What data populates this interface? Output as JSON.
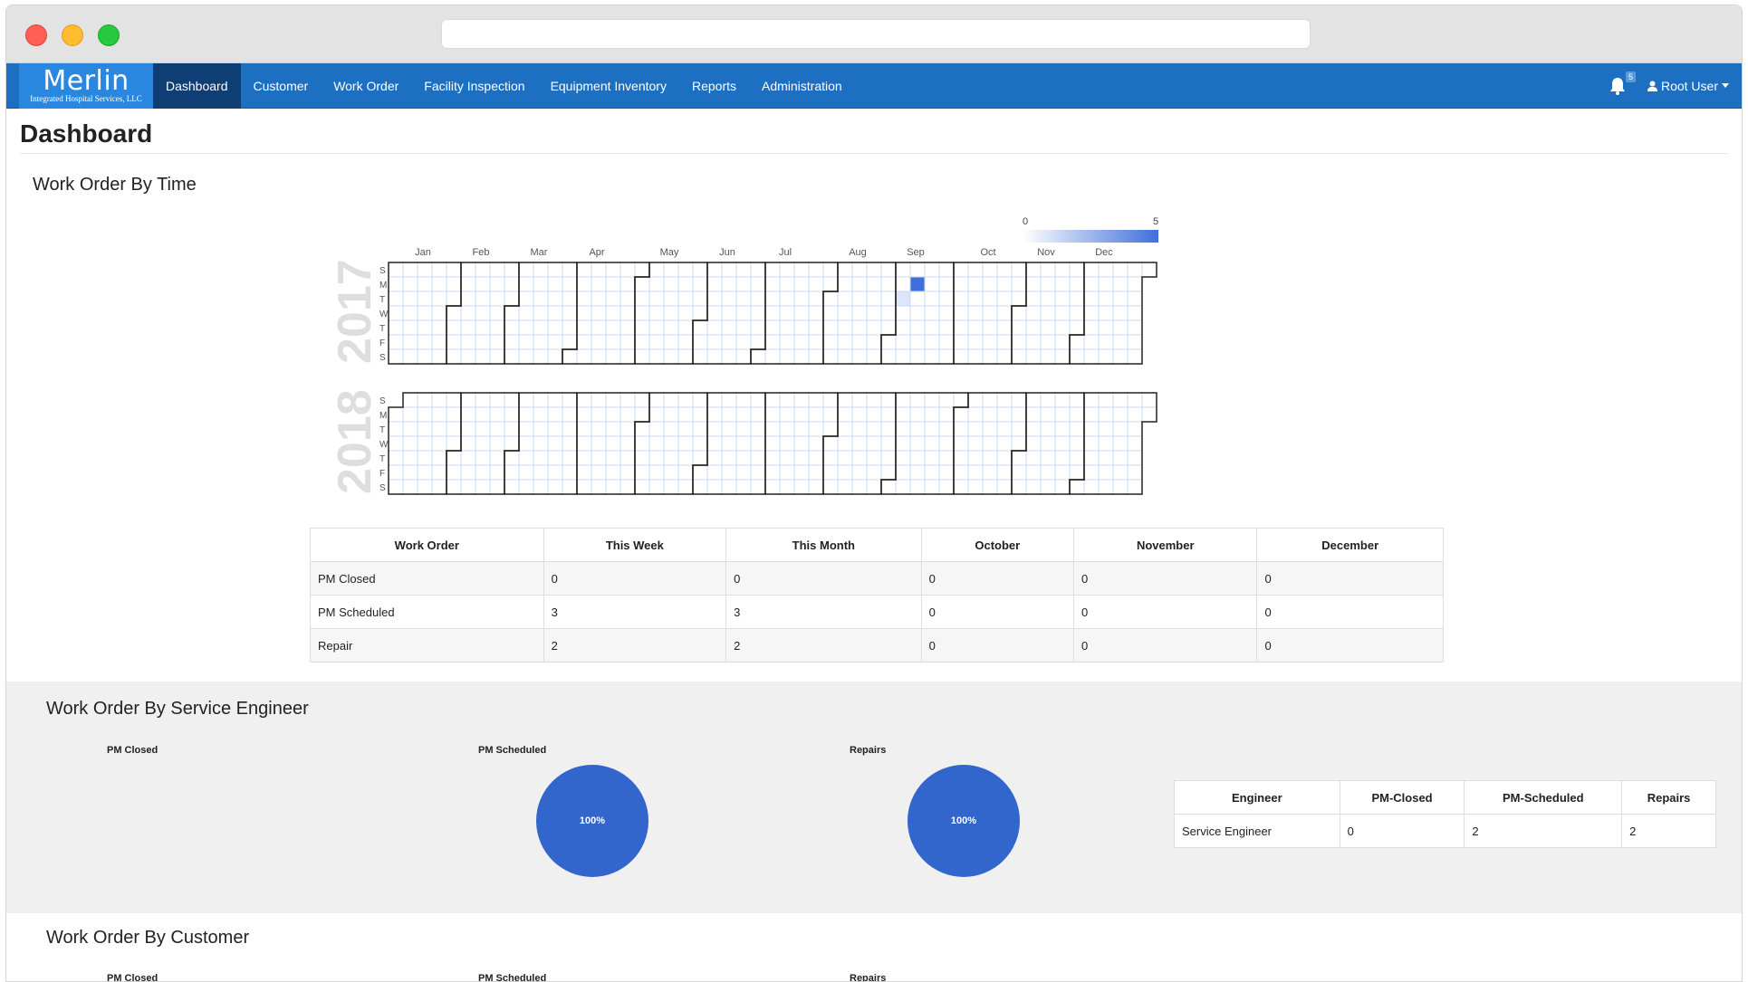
{
  "nav": {
    "brand_name": "Merlin",
    "brand_sub": "Integrated Hospital Services, LLC",
    "items": [
      "Dashboard",
      "Customer",
      "Work Order",
      "Facility Inspection",
      "Equipment Inventory",
      "Reports",
      "Administration"
    ],
    "active": "Dashboard",
    "notification_count": "5",
    "user_label": "Root User"
  },
  "page": {
    "title": "Dashboard"
  },
  "sections": {
    "by_time": "Work Order By Time",
    "by_engineer": "Work Order By Service Engineer",
    "by_customer": "Work Order By Customer"
  },
  "calendar": {
    "legend_min": "0",
    "legend_max": "5",
    "months": [
      "Jan",
      "Feb",
      "Mar",
      "Apr",
      "May",
      "Jun",
      "Jul",
      "Aug",
      "Sep",
      "Oct",
      "Nov",
      "Dec"
    ],
    "weekdays": [
      "S",
      "M",
      "T",
      "W",
      "T",
      "F",
      "S"
    ],
    "years": [
      "2017",
      "2018"
    ],
    "colors": {
      "empty": "#ffffff",
      "grid": "#c9d8f5",
      "high": "#3f6fdc",
      "low": "#dbe5fb",
      "border": "#222222"
    }
  },
  "work_order_table": {
    "headers": [
      "Work Order",
      "This Week",
      "This Month",
      "October",
      "November",
      "December"
    ],
    "rows": [
      [
        "PM Closed",
        "0",
        "0",
        "0",
        "0",
        "0"
      ],
      [
        "PM Scheduled",
        "3",
        "3",
        "0",
        "0",
        "0"
      ],
      [
        "Repair",
        "2",
        "2",
        "0",
        "0",
        "0"
      ]
    ]
  },
  "engineer_charts": [
    {
      "title": "PM Closed",
      "label": ""
    },
    {
      "title": "PM Scheduled",
      "label": "100%"
    },
    {
      "title": "Repairs",
      "label": "100%"
    }
  ],
  "engineer_table": {
    "headers": [
      "Engineer",
      "PM-Closed",
      "PM-Scheduled",
      "Repairs"
    ],
    "rows": [
      [
        "Service Engineer",
        "0",
        "2",
        "2"
      ]
    ]
  },
  "customer_charts": [
    {
      "title": "PM Closed"
    },
    {
      "title": "PM Scheduled"
    },
    {
      "title": "Repairs"
    }
  ],
  "colors": {
    "navbar": "#1c6fc1",
    "active_nav": "#0f3e74",
    "pie": "#3366cc"
  }
}
